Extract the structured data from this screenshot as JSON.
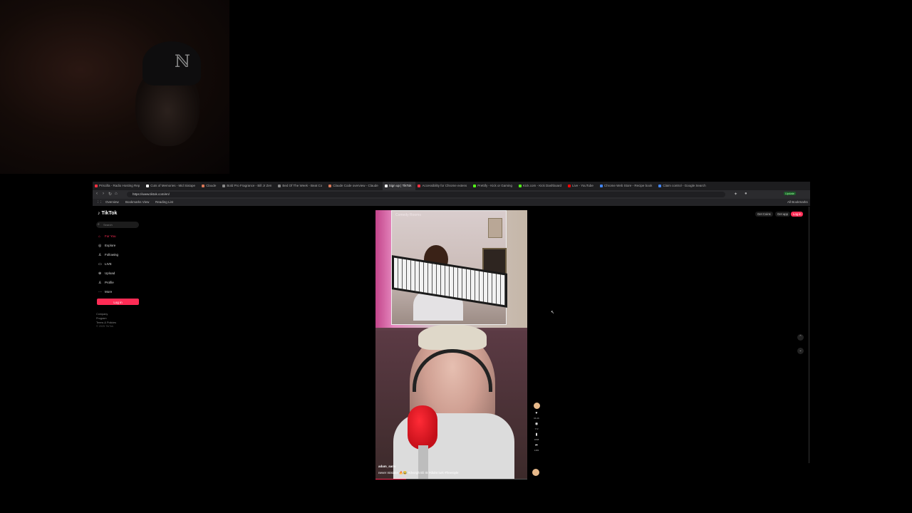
{
  "browser": {
    "tabs": [
      {
        "label": "Priscilla - Radio Hosting Rep",
        "color": "#ff3040"
      },
      {
        "label": "Cuts of Memories - Mid Sixtape",
        "color": "#ffffff"
      },
      {
        "label": "Claude",
        "color": "#d97757"
      },
      {
        "label": "Bold Pro Fragrance - Bill Jr Zen",
        "color": "#888888"
      },
      {
        "label": "Bed Of The Week - Beat Co",
        "color": "#888888"
      },
      {
        "label": "Claude Code overview - Claude",
        "color": "#d97757"
      },
      {
        "label": "Sign up | TikTok",
        "color": "#ffffff",
        "active": true
      },
      {
        "label": "Accessibility for Chrome extens",
        "color": "#ff3040"
      },
      {
        "label": "Prettify - Kick or Gaming",
        "color": "#53fc18"
      },
      {
        "label": "Kick.com - Kick Dashboard",
        "color": "#53fc18"
      },
      {
        "label": "Live - YouTube",
        "color": "#ff0000"
      },
      {
        "label": "Chrome Web Store - Recipe book",
        "color": "#4285f4"
      },
      {
        "label": "Claim control - Google Search",
        "color": "#4285f4"
      }
    ],
    "url": "https://www.tiktok.com/en/",
    "bookmarks": [
      "Overview",
      "Bookmarks View",
      "Reading List"
    ],
    "all_bookmarks": "All Bookmarks",
    "update_label": "Update"
  },
  "tiktok": {
    "logo": "TikTok",
    "search_placeholder": "Search",
    "nav": [
      {
        "label": "For You",
        "icon": "home-icon",
        "glyph": "⌂",
        "active": true
      },
      {
        "label": "Explore",
        "icon": "compass-icon",
        "glyph": "◎"
      },
      {
        "label": "Following",
        "icon": "following-icon",
        "glyph": "♙"
      },
      {
        "label": "LIVE",
        "icon": "live-icon",
        "glyph": "▭"
      },
      {
        "label": "Upload",
        "icon": "upload-icon",
        "glyph": "⊕"
      },
      {
        "label": "Profile",
        "icon": "profile-icon",
        "glyph": "♙"
      },
      {
        "label": "More",
        "icon": "more-icon",
        "glyph": "⋯"
      }
    ],
    "login_label": "Log in",
    "footer": [
      "Company",
      "Program",
      "Terms & Policies",
      "© 2025 TikTok"
    ],
    "get_coins": "Get Coins",
    "get_app": "Get app",
    "top_login": "Log in",
    "video": {
      "watermark": "Comedy Rooms",
      "username": "adam_sanv",
      "caption": "never mistake 🔥😂 #dvorgh Eli IS #didnt lurk #freestyle",
      "progress": 0.2
    },
    "actions": [
      {
        "icon": "heart-icon",
        "glyph": "♥",
        "count": "96.4K"
      },
      {
        "icon": "comment-icon",
        "glyph": "◉",
        "count": "772"
      },
      {
        "icon": "bookmark-icon",
        "glyph": "▮",
        "count": "1838"
      },
      {
        "icon": "share-icon",
        "glyph": "➦",
        "count": "1483"
      }
    ]
  }
}
